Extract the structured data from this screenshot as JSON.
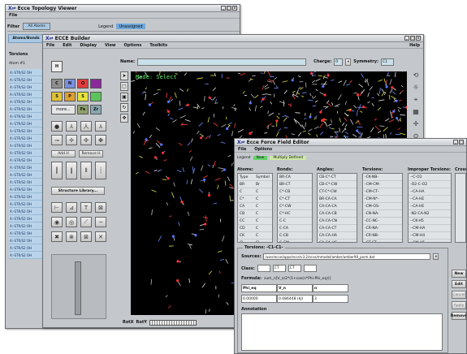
{
  "topology": {
    "title": "Ecce Topology Viewer",
    "menu": [
      "File"
    ],
    "filter_label": "Filter",
    "filter_tab": "All Atoms",
    "legend_label": "Legend",
    "legend_value": "Unassigned",
    "sub_tab": "Atoms/Bonds",
    "torsions_label": "Torsions",
    "col_header": "Atom #1",
    "rows": [
      "A:-STR/S2 OH",
      "A:-STR/S2 OH",
      "A:-STR/S2 OH",
      "A:-STR/S2 OH",
      "A:-STR/S2 OH",
      "A:-STR/S2 OH",
      "A:-STR/S2 OH",
      "A:-STR/S2 OH",
      "A:-STR/S2 OH",
      "A:-STR/S2 OH",
      "A:-STR/S2 OH",
      "A:-STR/S2 OH",
      "A:-STR/S2 OH",
      "A:-STR/S2 OH",
      "A:-STR/S2 OH",
      "A:-STR/S2 OH",
      "A:-STR/S2 OH",
      "A:-STR/S2 OH",
      "A:-STR/S2 OH",
      "A:-STR/S2 OH",
      "A:-STR/S2 OH",
      "A:-STR/S2 OH",
      "A:-STR/S2 OH",
      "A:-STR/S2 OH",
      "A:-STR/S2 OH",
      "A:-STR/S2 OH"
    ]
  },
  "builder": {
    "title": "ECCE Builder",
    "menu": [
      "File",
      "Edit",
      "Display",
      "View",
      "Options",
      "Toolkits"
    ],
    "help": "Help",
    "name_label": "Name:",
    "charge_label": "Charge:",
    "charge_value": "0",
    "symmetry_label": "Symmetry:",
    "symmetry_value": "C1",
    "element_h": "H",
    "elements": [
      "C",
      "N",
      "O",
      "S",
      "P",
      "S",
      "O",
      "",
      "Fe",
      "Zr"
    ],
    "more_label": "more...",
    "add_h": "Add H",
    "remove_h": "Remove H",
    "structure_library": "Structure Library...",
    "mode_text": "Mode: Select",
    "rotx": "RotX",
    "roty": "RotY"
  },
  "ffe": {
    "title": "Ecce Force Field Editor",
    "menu": [
      "File",
      "Options"
    ],
    "legend_label": "Legend",
    "legend_new": "New",
    "legend_multi": "Multiply Defined",
    "atoms": {
      "header": "Atoms:",
      "cols": [
        "Type",
        "Symbol"
      ],
      "rows": [
        [
          "BR",
          "Br"
        ],
        [
          "C",
          "C"
        ],
        [
          "C*",
          "C"
        ],
        [
          "CA",
          "C"
        ],
        [
          "CB",
          "C"
        ],
        [
          "CC",
          "C"
        ],
        [
          "CD",
          "C"
        ],
        [
          "CK",
          "C"
        ],
        [
          "CL",
          "Cl"
        ]
      ]
    },
    "bonds": {
      "header": "Bonds:",
      "rows": [
        "BR-CA",
        "BR-CT",
        "C*-CB",
        "C*-CT",
        "C*-CW",
        "C*-HC",
        "C-C",
        "C-CA",
        "C-CB",
        "C-CM",
        "C-CT"
      ]
    },
    "angles": {
      "header": "Angles:",
      "rows": [
        "CB-C*-CT",
        "CB-C*-CW",
        "CT-C*-CW",
        "BR-CA-CA",
        "CA-CA-CA",
        "CA-CA-CB",
        "CA-CA-CN",
        "CA-CA-CT",
        "CA-CA-HA",
        "CA-CA-HC"
      ]
    },
    "torsions": {
      "header": "Torsions:",
      "rows": [
        "-CK-NB-",
        "-CM-CM-",
        "-CM-CT-",
        "-CM-N*-",
        "-CM-OS-",
        "-CN-NA-",
        "-CC-NC-",
        "-CR-NA-",
        "-CR-NB-",
        "-CT-CT-",
        "-CT-CY-"
      ]
    },
    "improper": {
      "header": "Improper Torsions:",
      "rows": [
        "--C-O1",
        "-O2-C-O2",
        "--CA-HA",
        "--CA-HE",
        "--CA-HE",
        "-N2-CA-N2",
        "--CK-H5",
        "--CM-HA",
        "--CM-H4",
        "--CM-H5",
        "--CM-HA"
      ]
    },
    "cross_header": "Cross",
    "torsion_title": "Torsions: -C1-C1-",
    "sources_label": "Sources:",
    "sources_value": "/user/ecce/apps/ecce/v3.2/ecce/mmodel/amber/amber99_parm.dat",
    "class_label": "Class:",
    "class_values": [
      "",
      "CT",
      "CT",
      ""
    ],
    "formula_label": "Formula:",
    "formula_value": "sum_n[V_n/2*(1+cos(n*Phi-Phi_eq))]",
    "param_headers": [
      "Phi_eq",
      "V_n",
      "n"
    ],
    "param_values": [
      "0.00000",
      "0.086448 (kJ)",
      "3"
    ],
    "annotation_label": "Annotation",
    "side_buttons": [
      "New",
      "Edit",
      "Cancel",
      "Apply",
      "Remove"
    ]
  }
}
